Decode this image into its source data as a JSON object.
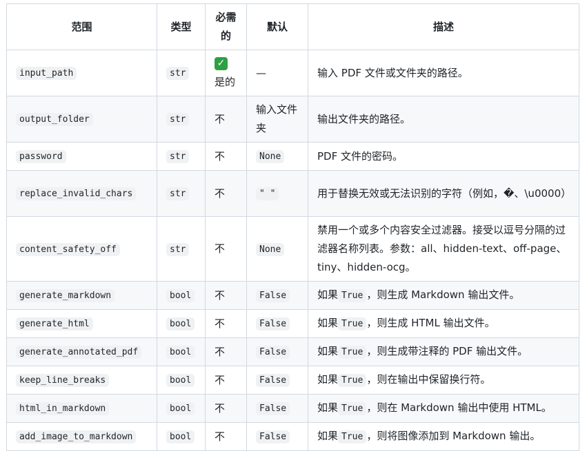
{
  "headers": {
    "range": "范围",
    "type": "类型",
    "required": "必需的",
    "default": "默认",
    "description": "描述"
  },
  "rows": [
    {
      "name": "input_path",
      "type": "str",
      "required_icon": "check-mark-icon",
      "required": "是的",
      "default": "—",
      "desc": "输入 PDF 文件或文件夹的路径。"
    },
    {
      "name": "output_folder",
      "type": "str",
      "required": "不",
      "default": "输入文件夹",
      "desc": "输出文件夹的路径。"
    },
    {
      "name": "password",
      "type": "str",
      "required": "不",
      "default": "None",
      "desc": "PDF 文件的密码。"
    },
    {
      "name": "replace_invalid_chars",
      "type": "str",
      "required": "不",
      "default": "\" \"",
      "desc": "用于替换无效或无法识别的字符（例如，�、\\u0000）"
    },
    {
      "name": "content_safety_off",
      "type": "str",
      "required": "不",
      "default": "None",
      "desc": "禁用一个或多个内容安全过滤器。接受以逗号分隔的过滤器名称列表。参数：all、hidden-text、off-page、tiny、hidden-ocg。"
    },
    {
      "name": "generate_markdown",
      "type": "bool",
      "required": "不",
      "default": "False",
      "desc_pre": "如果",
      "desc_code": "True",
      "desc_post": "，则生成 Markdown 输出文件。"
    },
    {
      "name": "generate_html",
      "type": "bool",
      "required": "不",
      "default": "False",
      "desc_pre": "如果",
      "desc_code": "True",
      "desc_post": "，则生成 HTML 输出文件。"
    },
    {
      "name": "generate_annotated_pdf",
      "type": "bool",
      "required": "不",
      "default": "False",
      "desc_pre": "如果",
      "desc_code": "True",
      "desc_post": "，则生成带注释的 PDF 输出文件。"
    },
    {
      "name": "keep_line_breaks",
      "type": "bool",
      "required": "不",
      "default": "False",
      "desc_pre": "如果",
      "desc_code": "True",
      "desc_post": "，则在输出中保留换行符。"
    },
    {
      "name": "html_in_markdown",
      "type": "bool",
      "required": "不",
      "default": "False",
      "desc_pre": "如果",
      "desc_code": "True",
      "desc_post": "，则在 Markdown 输出中使用 HTML。"
    },
    {
      "name": "add_image_to_markdown",
      "type": "bool",
      "required": "不",
      "default": "False",
      "desc_pre": "如果",
      "desc_code": "True",
      "desc_post": "，则将图像添加到 Markdown 输出。"
    }
  ]
}
